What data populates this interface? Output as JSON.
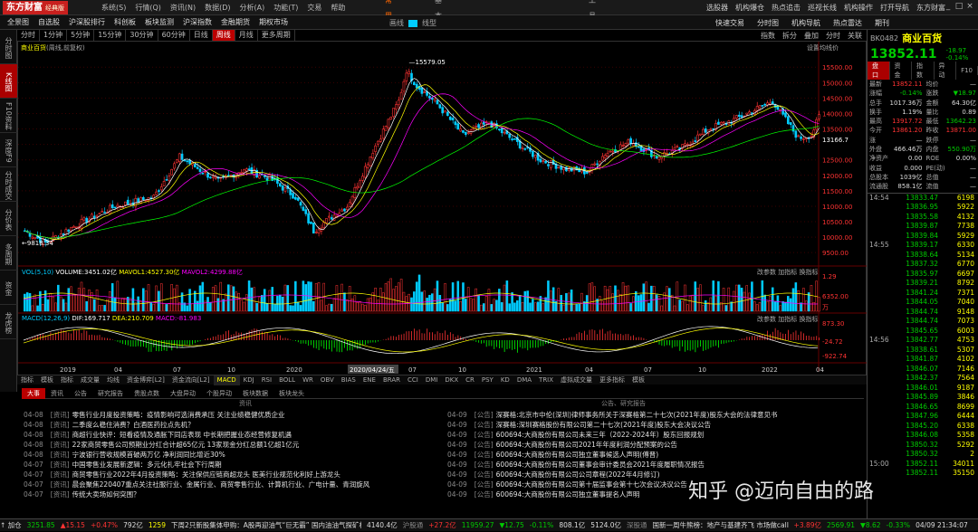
{
  "app": {
    "logo": "东方财富",
    "logo_sub": "经典版",
    "menu": [
      "系统(S)",
      "行情(Q)",
      "资讯(N)",
      "数据(D)",
      "分析(A)",
      "功能(T)",
      "交易",
      "帮助"
    ],
    "groups": [
      "常用",
      "基本",
      "工具"
    ],
    "top_right": [
      "选股器",
      "机构爆仓",
      "热点追击",
      "巡视长线",
      "机构操作",
      "打开导航",
      "东方财富"
    ],
    "win": [
      "_",
      "□",
      "×"
    ]
  },
  "row2": [
    "全景图",
    "自选股",
    "沪深股排行",
    "科创板",
    "板块监测",
    "沪深指数",
    "金融期货",
    "期权市场"
  ],
  "row2_mid": [
    "画线",
    "线型"
  ],
  "row2_right": [
    "快速交易",
    "分时图",
    "机构导航",
    "热点雷达",
    "期刊"
  ],
  "periods": [
    "分时",
    "1分钟",
    "5分钟",
    "15分钟",
    "30分钟",
    "60分钟",
    "日线",
    "周线",
    "月线",
    "更多周期"
  ],
  "period_active": "周线",
  "chart_toolbar": [
    "指数",
    "拆分",
    "叠加",
    "分时",
    "关联",
    "筑力"
  ],
  "sidetabs": [
    "分时图",
    "K线图",
    "F10资料",
    "深度F9",
    "分时成交",
    "分价表",
    "多周期",
    "资金",
    "龙虎榜"
  ],
  "sidetab_active": "K线图",
  "chart": {
    "title": "商业百货",
    "title_sub": "(周线,前复权)",
    "settings": "设置均线价",
    "high_label": "15579.05",
    "low_label": "9818.34",
    "price_ticks": [
      "15500.00",
      "15000.00",
      "14500.00",
      "14000.00",
      "13500.00",
      "13166.7",
      "12500.00",
      "12000.00",
      "11500.00",
      "11000.00",
      "10500.00",
      "10000.00",
      "9500.00"
    ],
    "last_price_tag": "13166.7",
    "vol_label": "VOL(5,10)",
    "vol_val": "VOLUME:3451.02亿",
    "vol_ma1": "MAVOL1:4527.30亿",
    "vol_ma2": "MAVOL2:4299.88亿",
    "vol_ticks": [
      "1.29",
      "6352.00",
      "万"
    ],
    "macd_label": "MACD(12,26,9)",
    "macd_dif": "DIF:169.717",
    "macd_dea": "DEA:210.709",
    "macd_val": "MACD:-81.983",
    "macd_ticks": [
      "873.30",
      "-24.72",
      "-922.74"
    ],
    "sub_tools": [
      "改参数",
      "加指标",
      "换指标"
    ],
    "x_labels": [
      "2019",
      "04",
      "07",
      "10",
      "2020",
      "2020/04/24/五",
      "07",
      "10",
      "2021",
      "04",
      "07",
      "10",
      "2022",
      "04"
    ]
  },
  "indicators": [
    "指标",
    "模板",
    "指标",
    "成交量",
    "均线",
    "资金博弈[L2]",
    "资金流向[L2]",
    "MACD",
    "KDJ",
    "RSI",
    "BOLL",
    "WR",
    "OBV",
    "BIAS",
    "ENE",
    "BRAR",
    "CCI",
    "DMI",
    "DKX",
    "CR",
    "PSY",
    "KD",
    "DMA",
    "TRIX",
    "虚拟成交量",
    "更多指标",
    "模板"
  ],
  "indicator_active": "MACD",
  "news": {
    "tabs": [
      "大事",
      "资讯",
      "公告",
      "研究报告",
      "贵股点数",
      "大盘异动",
      "个股异动",
      "板块数据",
      "板块龙头"
    ],
    "tab_active": "大事",
    "left_header": "资讯",
    "right_header": "公告、研究报告",
    "left": [
      {
        "d": "04-08",
        "t": "[资讯]",
        "x": "零售行业月度投资策略：疫情影响可选消费承压 关注业绩稳健优质企业"
      },
      {
        "d": "04-08",
        "t": "[资讯]",
        "x": "二季度么稳住消费？白酒医药拉点先机？"
      },
      {
        "d": "04-08",
        "t": "[资讯]",
        "x": "商超行业快评：短看疫情及通胀下同店表现 中长期把握业态经营修复机遇"
      },
      {
        "d": "04-08",
        "t": "[资讯]",
        "x": "22家商贸零售公司预期业分红合计超65亿元 13家现金分红总额1亿超1亿元"
      },
      {
        "d": "04-08",
        "t": "[资讯]",
        "x": "宁波银行营收规模首破两万亿 净利润同比增近30%"
      },
      {
        "d": "04-07",
        "t": "[资讯]",
        "x": "中国零售业发展新逻辑：多元化扎牢社会下行周期"
      },
      {
        "d": "04-07",
        "t": "[资讯]",
        "x": "商贸零售行业2022年4月投资策略：关注保供应链商超龙头 医美行业规范化利好上游龙头"
      },
      {
        "d": "04-07",
        "t": "[资讯]",
        "x": "晨会聚焦220407重点关注社服行业、金属行业、商贸零售行业、计算机行业、广电计量、青润旋风"
      },
      {
        "d": "04-07",
        "t": "[资讯]",
        "x": "传统大卖场如何突围？"
      }
    ],
    "right": [
      {
        "d": "04-09",
        "t": "[公告]",
        "x": "深赛格:北京市中伦(深圳)律师事务所关于深赛格第二十七次(2021年度)股东大会的法律意见书"
      },
      {
        "d": "04-09",
        "t": "[公告]",
        "x": "深赛格:深圳赛格股份有限公司第二十七次(2021年度)股东大会决议公告"
      },
      {
        "d": "04-09",
        "t": "[公告]",
        "x": "600694:大商股份有限公司未来三年（2022-2024年）股东回报规划"
      },
      {
        "d": "04-09",
        "t": "[公告]",
        "x": "600694:大商股份有限公司2021年年度利润分配预案的公告"
      },
      {
        "d": "04-09",
        "t": "[公告]",
        "x": "600694:大商股份有限公司独立董事候选人声明(傅晋)"
      },
      {
        "d": "04-09",
        "t": "[公告]",
        "x": "600694:大商股份有限公司董事会审计委员会2021年度履职情况报告"
      },
      {
        "d": "04-09",
        "t": "[公告]",
        "x": "600694:大商股份有限公司公司章程(2022年4月修订)"
      },
      {
        "d": "04-09",
        "t": "[公告]",
        "x": "600694:大商股份有限公司第十届监事会第十七次会议决议公告"
      },
      {
        "d": "04-09",
        "t": "[公告]",
        "x": "600694:大商股份有限公司独立董事提名人声明"
      }
    ]
  },
  "rp": {
    "code": "BK0482",
    "name": "商业百货",
    "price": "13852.11",
    "chg": "-18.97",
    "pct": "-0.14%",
    "tabs": [
      "盘口",
      "资金",
      "指数",
      "异动",
      "F10"
    ],
    "tab_active": "盘口",
    "kv": [
      [
        "最新",
        "13852.11",
        "均价",
        "—"
      ],
      [
        "涨幅",
        "-0.14%",
        "涨跌",
        "▼18.97"
      ],
      [
        "总手",
        "1017.36万",
        "金额",
        "64.30亿"
      ],
      [
        "换手",
        "1.19%",
        "量比",
        "0.89"
      ],
      [
        "最高",
        "13917.72",
        "最低",
        "13642.23"
      ],
      [
        "今开",
        "13861.20",
        "昨收",
        "13871.00"
      ],
      [
        "涨",
        "—",
        "跌停",
        "—"
      ],
      [
        "外盘",
        "466.46万",
        "内盘",
        "550.90万"
      ],
      [
        "净资产",
        "0.00",
        "ROE",
        "0.00%"
      ],
      [
        "收益",
        "0.000",
        "PE(动)",
        "—"
      ],
      [
        "总股本",
        "1039亿",
        "总值",
        "—"
      ],
      [
        "流通股",
        "858.1亿",
        "流值",
        "—"
      ]
    ],
    "ticks": [
      [
        "14:54",
        "13833.47",
        "6198"
      ],
      [
        "",
        "13836.95",
        "5922"
      ],
      [
        "",
        "13835.58",
        "4132"
      ],
      [
        "",
        "13839.87",
        "7738"
      ],
      [
        "",
        "13839.84",
        "5929"
      ],
      [
        "14:55",
        "13839.17",
        "6330"
      ],
      [
        "",
        "13838.64",
        "5134"
      ],
      [
        "",
        "13837.32",
        "6770"
      ],
      [
        "",
        "13835.97",
        "6697"
      ],
      [
        "",
        "13839.21",
        "8792"
      ],
      [
        "",
        "13841.24",
        "7371"
      ],
      [
        "",
        "13844.05",
        "7040"
      ],
      [
        "",
        "13844.74",
        "9148"
      ],
      [
        "",
        "13844.74",
        "7073"
      ],
      [
        "",
        "13845.65",
        "6003"
      ],
      [
        "14:56",
        "13842.77",
        "4753"
      ],
      [
        "",
        "13838.61",
        "5307"
      ],
      [
        "",
        "13841.87",
        "4102"
      ],
      [
        "",
        "13846.07",
        "7146"
      ],
      [
        "",
        "13842.37",
        "7564"
      ],
      [
        "",
        "13846.01",
        "9187"
      ],
      [
        "",
        "13845.89",
        "3846"
      ],
      [
        "",
        "13846.65",
        "8699"
      ],
      [
        "",
        "13847.96",
        "6444"
      ],
      [
        "",
        "13845.20",
        "6338"
      ],
      [
        "",
        "13846.08",
        "5358"
      ],
      [
        "",
        "13850.32",
        "5292"
      ],
      [
        "",
        "13850.32",
        "2"
      ],
      [
        "15:00",
        "13852.11",
        "34011"
      ],
      [
        "",
        "13852.11",
        "35150"
      ]
    ]
  },
  "footer": [
    {
      "t": "↑ 加仓",
      "c": "w"
    },
    {
      "t": "3251.85",
      "c": "g"
    },
    {
      "t": "▲15.15",
      "c": "r"
    },
    {
      "t": "+0.47%",
      "c": "r"
    },
    {
      "t": "792亿",
      "c": "w"
    },
    {
      "t": "1259",
      "c": "y"
    },
    {
      "t": "4140.4亿",
      "c": "w"
    },
    {
      "t": "沪股通",
      "c": "gr"
    },
    {
      "t": "+27.2亿",
      "c": "r"
    },
    {
      "t": "11959.27",
      "c": "g"
    },
    {
      "t": "▼12.75",
      "c": "g"
    },
    {
      "t": "-0.11%",
      "c": "g"
    },
    {
      "t": "808.1亿",
      "c": "w"
    },
    {
      "t": "5124.0亿",
      "c": "w"
    },
    {
      "t": "深股通",
      "c": "gr"
    },
    {
      "t": "+3.89亿",
      "c": "r"
    },
    {
      "t": "2569.91",
      "c": "g"
    },
    {
      "t": "▼8.62",
      "c": "g"
    },
    {
      "t": "-0.33%",
      "c": "g"
    },
    {
      "t": "04/09 21:34:07",
      "c": "w"
    }
  ],
  "ticker": "下周2只新股集体申购：A股再迎油气“巨无霸” 国内油油气探矿权占比超9成 还有国家大基金持股的主控芯",
  "ticker2": "国新一周牛熊榜：地产与基建齐飞 市场做calI强槽长",
  "watermark": "知乎 @迈向自由的路"
}
